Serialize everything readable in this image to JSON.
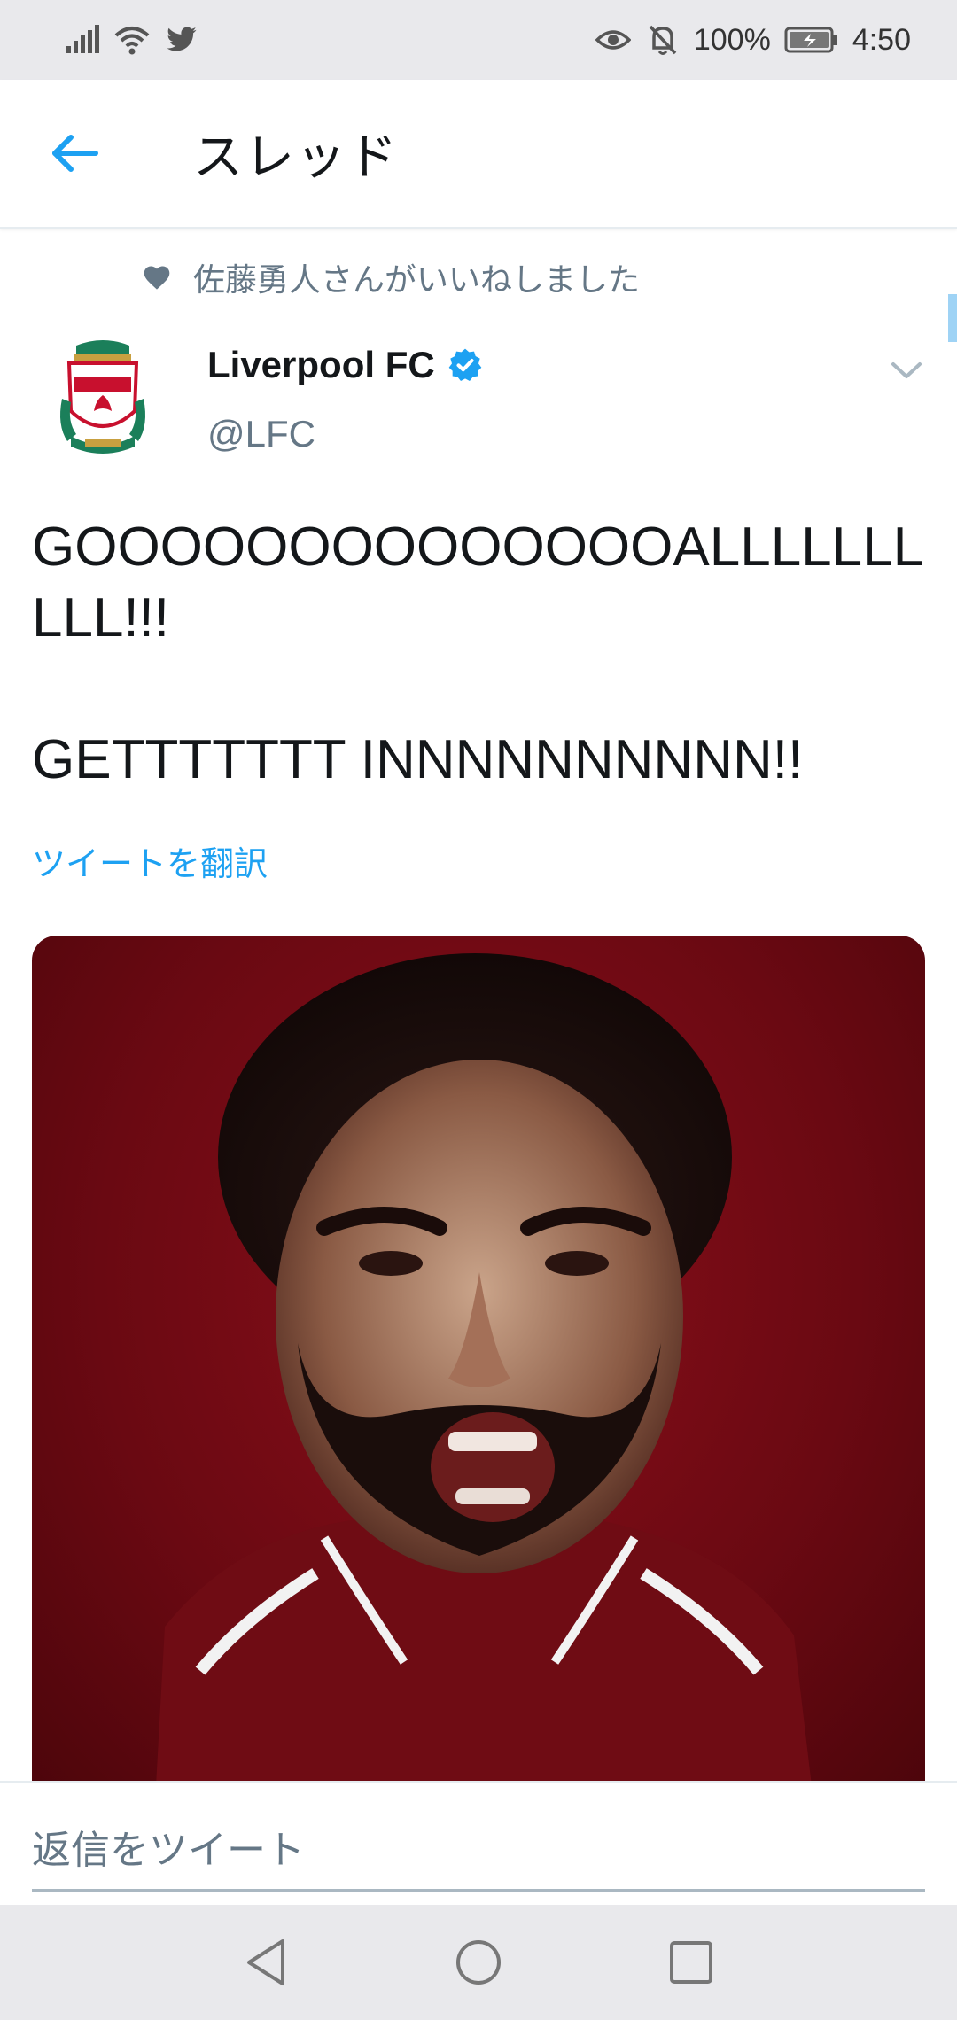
{
  "status_bar": {
    "battery_percent": "100%",
    "time": "4:50",
    "icons": [
      "signal-icon",
      "wifi-icon",
      "twitter-icon",
      "eye-icon",
      "notifications-off-icon",
      "battery-icon"
    ]
  },
  "header": {
    "title": "スレッド",
    "back_icon": "arrow-left-icon"
  },
  "social_context": {
    "icon": "heart-icon",
    "text": "佐藤勇人さんがいいねしました"
  },
  "tweet": {
    "author_name": "Liverpool FC",
    "verified": true,
    "handle": "@LFC",
    "text": "GOOOOOOOOOOOOOOALLLLLLLLLL!!!\n\nGETTTTTTT INNNNNNNNNN!!",
    "translate_label": "ツイートを翻訳",
    "media": {
      "type": "video-still"
    }
  },
  "reply": {
    "placeholder": "返信をツイート"
  },
  "colors": {
    "accent": "#1da1f2",
    "secondary_text": "#657786",
    "primary_text": "#14171a",
    "system_bar": "#e9e9ec"
  }
}
